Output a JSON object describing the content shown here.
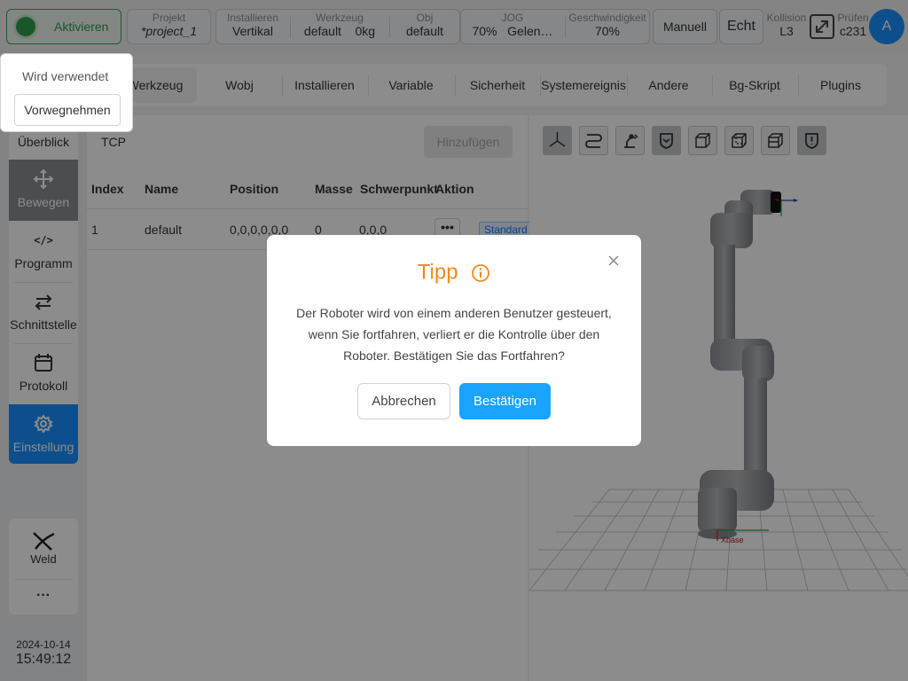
{
  "topbar": {
    "activate_label": "Aktivieren",
    "project": {
      "label": "Projekt",
      "value": "*project_1"
    },
    "install": {
      "label": "Installieren",
      "value": "Vertikal"
    },
    "tool": {
      "label": "Werkzeug",
      "value": "default",
      "extra": "0kg"
    },
    "obj": {
      "label": "Obj",
      "value": "default"
    },
    "jog": {
      "label": "JOG",
      "value": "70%",
      "extra": "Gelen…"
    },
    "speed": {
      "label": "Geschwindigkeit",
      "value": "70%"
    },
    "manual_label": "Manuell",
    "real_label": "Echt",
    "collision": {
      "label": "Kollision",
      "value": "L3"
    },
    "check": {
      "label": "Prüfen",
      "value": "c231"
    },
    "avatar_letter": "A"
  },
  "popover": {
    "in_use": "Wird verwendet",
    "preempt": "Vorwegnehmen"
  },
  "sidebar": {
    "items": [
      {
        "label": "Überblick"
      },
      {
        "label": "Bewegen"
      },
      {
        "label": "Programm"
      },
      {
        "label": "Schnittstelle"
      },
      {
        "label": "Protokoll"
      },
      {
        "label": "Einstellung"
      }
    ],
    "weld_label": "Weld",
    "more_label": "···",
    "date": "2024-10-14",
    "time": "15:49:12"
  },
  "tabs": [
    "Werkzeug",
    "Wobj",
    "Installieren",
    "Variable",
    "Sicherheit",
    "Systemereignis",
    "Andere",
    "Bg-Skript",
    "Plugins"
  ],
  "panel": {
    "subtab": "TCP",
    "add_label": "Hinzufügen",
    "columns": [
      "Index",
      "Name",
      "Position",
      "Masse",
      "Schwerpunkt",
      "Aktion"
    ],
    "rows": [
      {
        "index": "1",
        "name": "default",
        "position": "0,0,0,0,0,0",
        "mass": "0",
        "cog": "0,0,0",
        "action": "•••",
        "tag": "Standard"
      }
    ]
  },
  "view3d": {
    "axis_label": "Xbase"
  },
  "modal": {
    "title": "Tipp",
    "message_lines": [
      "Der Roboter wird von einem anderen Benutzer gesteuert,",
      "wenn Sie fortfahren, verliert er die Kontrolle über den",
      "Roboter. Bestätigen Sie das Fortfahren?"
    ],
    "cancel_label": "Abbrechen",
    "confirm_label": "Bestätigen"
  },
  "colors": {
    "accent": "#1aa3ff",
    "active_green": "#2e9e4a",
    "tip_orange": "#f08a1c",
    "nav_blue": "#1890ff"
  }
}
